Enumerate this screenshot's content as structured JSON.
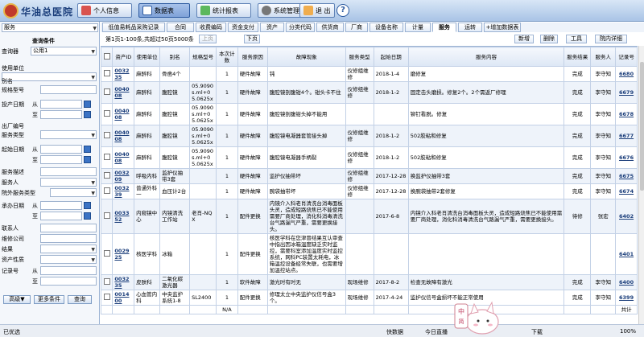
{
  "header": {
    "title": "华油总医院",
    "buttons": [
      {
        "label": "个人信息",
        "icon": "person-icon"
      },
      {
        "label": "数据表",
        "icon": "table-icon"
      },
      {
        "label": "统计报表",
        "icon": "chart-icon"
      },
      {
        "label": "系统管理",
        "icon": "gear-icon"
      },
      {
        "label": "退 出",
        "icon": "exit-icon"
      }
    ],
    "help": "?"
  },
  "sidebar": {
    "module": "服务",
    "title": "查询条件",
    "fields": {
      "query_user_label": "查询器",
      "query_user_value": "公用1",
      "use_unit": "使用单位",
      "alias": "别名",
      "spec_model": "规格型号",
      "invest_date": "投产日期",
      "from": "从",
      "to": "至",
      "factory_no": "出厂编号",
      "service_type": "服务类型",
      "start_date": "起始日期",
      "service_desc": "服务描述",
      "service_person": "服务人",
      "outside_type": "院外服务类型",
      "undertake_date": "承办日期",
      "contact": "联系人",
      "repair_company": "维修公司",
      "result": "结果",
      "asset_type": "资产性质",
      "record_no": "记录号"
    },
    "buttons": {
      "advanced": "高级▼",
      "more": "更多条件",
      "query": "查询"
    }
  },
  "tabs": [
    "低值易耗品采购记录",
    "合同",
    "收费编码",
    "资金支付",
    "资产",
    "分类代码",
    "供货商",
    "厂商",
    "设备名称",
    "计量",
    "服务",
    "运转",
    "+增加数据表"
  ],
  "active_tab": "服务",
  "pager": {
    "info": "第1页1-100条,共超过50页5000条",
    "prev": "上页",
    "next": "下页",
    "new": "新增",
    "delete": "删除",
    "tools": "工具",
    "detail": "院内详细"
  },
  "table": {
    "headers": [
      "资产ID",
      "使用单位",
      "别名",
      "规格型号",
      "本次计数",
      "服务原因",
      "故障现象",
      "服务类型",
      "起始日期",
      "服务内容",
      "服务结果",
      "服务人",
      "记录号"
    ],
    "rows": [
      {
        "id": "003235",
        "unit": "麻醉科",
        "alias": "骨凿4个",
        "spec": "",
        "count": "1",
        "reason": "硬件故障",
        "symptom": "钝",
        "type": "仪修组维修",
        "date": "2018-1-4",
        "content": "磨修复",
        "result": "完成",
        "person": "李守知",
        "rec": "6680"
      },
      {
        "id": "004008",
        "unit": "麻醉科",
        "alias": "腹腔镜",
        "spec": "05.9090s.ml+05.0625x",
        "count": "1",
        "reason": "硬件故障",
        "symptom": "腹腔镜剖腹钳4个。钳头卡不住",
        "type": "仪修组维修",
        "date": "2018-1-2",
        "content": "固定击头磨损。修复2个。2个需返厂修理",
        "result": "完成",
        "person": "李守知",
        "rec": "6679"
      },
      {
        "id": "004008",
        "unit": "麻醉科",
        "alias": "腹腔镜",
        "spec": "05.9090s.ml+05.0625x",
        "count": "1",
        "reason": "硬件故障",
        "symptom": "腹腔镜剖腹钳头掉不能用",
        "type": "",
        "date": "",
        "content": "铆钉看脱。修复",
        "result": "完成",
        "person": "李守知",
        "rec": "6678"
      },
      {
        "id": "004008",
        "unit": "麻醉科",
        "alias": "腹腔镜",
        "spec": "05.9090s.ml+05.0625x",
        "count": "1",
        "reason": "硬件故障",
        "symptom": "腹腔镜电凝器套管接头掉",
        "type": "仪修组维修",
        "date": "2018-1-2",
        "content": "502胶粘和修复",
        "result": "完成",
        "person": "李守知",
        "rec": "6677"
      },
      {
        "id": "004008",
        "unit": "麻醉科",
        "alias": "腹腔镜",
        "spec": "05.9090s.ml+05.0625x",
        "count": "1",
        "reason": "硬件故障",
        "symptom": "腹腔镜电凝器手柄裂",
        "type": "仪修组维修",
        "date": "2018-1-2",
        "content": "502胶粘和修复",
        "result": "完成",
        "person": "李守知",
        "rec": "6676"
      },
      {
        "id": "003209",
        "unit": "呼吸内科",
        "alias": "监护仪抽带3套",
        "spec": "",
        "count": "1",
        "reason": "硬件故障",
        "symptom": "监护仪抽带坏",
        "type": "仪修组维修",
        "date": "2017-12-28",
        "content": "换监护仪抽带3套",
        "result": "完成",
        "person": "李守知",
        "rec": "6675"
      },
      {
        "id": "003239",
        "unit": "普通外科一",
        "alias": "血压计2台",
        "spec": "",
        "count": "1",
        "reason": "硬件故障",
        "symptom": "腕袋抽带坏",
        "type": "仪修组维修",
        "date": "2017-12-28",
        "content": "换腕袋抽带2套修复",
        "result": "完成",
        "person": "李守知",
        "rec": "6674"
      },
      {
        "id": "003352",
        "unit": "内窥镜中心",
        "alias": "内镜清洗工作站",
        "spec": "老肖-NQX",
        "count": "1",
        "reason": "配件更换",
        "symptom": "内镜介入科老肖清洗台消毒面板头灵，造成短路烧焦已不能使用需要厂商处理，消化科消毒清洗台气路漏气严重，需要更换接头。",
        "type": "",
        "date": "2017-6-8",
        "content": "内镜介入科老肖清洗台消毒面板头灵，造成短路烧焦已不能使用需要厂商处理，消化科消毒清洗台气路漏气严重，需要更换接头。",
        "result": "待修",
        "person": "张宏",
        "rec": "6402"
      },
      {
        "id": "002925",
        "unit": "核医学科",
        "alias": "冰箱",
        "spec": "",
        "count": "1",
        "reason": "配件更换",
        "symptom": "核医学科在您津冒结果互认审查中指出因冰箱温度缺乏实时监控，需要科室添加温度实时监控系统，网科PC装置太耗电，冰箱温控设备经常失联，也需要增加温控站点。",
        "type": "",
        "date": "",
        "content": "",
        "result": "",
        "person": "",
        "rec": "6401"
      },
      {
        "id": "003235",
        "unit": "皮肤科",
        "alias": "二氧化碳激光器",
        "spec": "",
        "count": "1",
        "reason": "软件故障",
        "symptom": "激光时有时无",
        "type": "现场维修",
        "date": "2017-8-2",
        "content": "检查无故障有激光",
        "result": "完成",
        "person": "李守知",
        "rec": "6400"
      },
      {
        "id": "001400",
        "unit": "心血管内科",
        "alias": "中央监护系统1-8",
        "spec": "SL2400",
        "count": "1",
        "reason": "配件更换",
        "symptom": "修理太立中央监护仪信号盒3个。",
        "type": "现场维修",
        "date": "2017-4-24",
        "content": "监护仪信号盒损坏不能正常使用",
        "result": "完成",
        "person": "李守知",
        "rec": "6399"
      }
    ],
    "footer_na": "N/A",
    "footer_total": "共计"
  },
  "status": {
    "left": "已优选",
    "quick_search": "快数据",
    "today_direct": "今日直播",
    "download": "下载",
    "zoom": "100%",
    "mascot_text": "中 简"
  },
  "colors": {
    "header_bg": "#a9c4e6",
    "link": "#1a3d7a",
    "row_alt": "#eef3fa"
  }
}
